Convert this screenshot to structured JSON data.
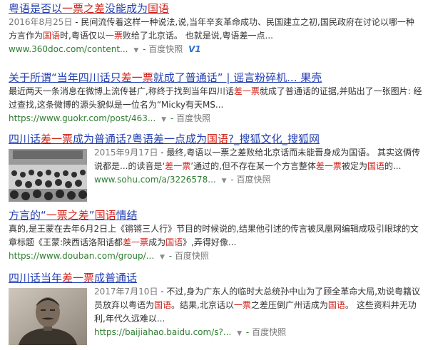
{
  "results": [
    {
      "title": [
        {
          "t": "粤语是否以",
          "hl": false
        },
        {
          "t": "一票之差",
          "hl": true
        },
        {
          "t": "没能成为",
          "hl": false
        },
        {
          "t": "国语",
          "hl": true
        }
      ],
      "date": "2016年8月25日",
      "abstract": [
        {
          "t": " - 民间流传着这样一种说法,说,当年辛亥革命成功、民国建立之初,国民政府在讨论以哪一种方言作为",
          "hl": false
        },
        {
          "t": "国语",
          "hl": true
        },
        {
          "t": "时,粤语仅以",
          "hl": false
        },
        {
          "t": "一票",
          "hl": true
        },
        {
          "t": "败给了北京话。 也就是说,粤语差一点...",
          "hl": false
        }
      ],
      "url": "www.360doc.com/content...",
      "badge": "V1",
      "snapshot": "百度快照"
    },
    {
      "title": [
        {
          "t": "关于所谓“当年四川话只",
          "hl": false
        },
        {
          "t": "差一票",
          "hl": true
        },
        {
          "t": "就成了普通话” | 谣言粉碎机... 果壳",
          "hl": false
        }
      ],
      "date": "",
      "abstract": [
        {
          "t": "最近两天一条消息在微博上流传甚广,称终于找到当年四川话",
          "hl": false
        },
        {
          "t": "差一票",
          "hl": true
        },
        {
          "t": "就成了普通话的证据,并贴出了一张图片: 经过查找,这条微博的源头貌似是一位名为“Micky有天MS...",
          "hl": false
        }
      ],
      "url": "https://www.guokr.com/post/463...",
      "badge": "",
      "snapshot": "百度快照"
    },
    {
      "title": [
        {
          "t": "四川话",
          "hl": false
        },
        {
          "t": "差一票",
          "hl": true
        },
        {
          "t": "成为普通话?粤语差一点成为",
          "hl": false
        },
        {
          "t": "国语",
          "hl": true
        },
        {
          "t": "?_搜狐文化_搜狐网",
          "hl": false
        }
      ],
      "date": "2015年9月17日",
      "abstract": [
        {
          "t": " - 最终,粤语以一票之差败给北京话而未能晋身成为国语。 其实这俩传说都是...的读音是‘",
          "hl": false
        },
        {
          "t": "差一票",
          "hl": true
        },
        {
          "t": "’通过的,但不存在某一个方言整体",
          "hl": false
        },
        {
          "t": "差一票",
          "hl": true
        },
        {
          "t": "被定为",
          "hl": false
        },
        {
          "t": "国语",
          "hl": true
        },
        {
          "t": "的...",
          "hl": false
        }
      ],
      "url": "www.sohu.com/a/3226578...",
      "badge": "",
      "snapshot": "百度快照"
    },
    {
      "title": [
        {
          "t": "方言的“",
          "hl": false
        },
        {
          "t": "一票之差",
          "hl": true
        },
        {
          "t": "”",
          "hl": false
        },
        {
          "t": "国语",
          "hl": true
        },
        {
          "t": "情结",
          "hl": false
        }
      ],
      "date": "",
      "abstract": [
        {
          "t": "真的,是王蒙在去年6月2日上《锵锵三人行》节目的时候说的,结果他引述的传言被凤凰网编辑成吸引眼球的文章标题《王蒙:陕西话洛阳话都",
          "hl": false
        },
        {
          "t": "差一票",
          "hl": true
        },
        {
          "t": "成为",
          "hl": false
        },
        {
          "t": "国语",
          "hl": true
        },
        {
          "t": "》,弄得好像...",
          "hl": false
        }
      ],
      "url": "https://www.douban.com/group/...",
      "badge": "",
      "snapshot": "百度快照"
    },
    {
      "title": [
        {
          "t": "四川话当年",
          "hl": false
        },
        {
          "t": "差一票",
          "hl": true
        },
        {
          "t": "成普通话",
          "hl": false
        }
      ],
      "date": "2017年7月10日",
      "abstract": [
        {
          "t": " - 不过,身为广东人的临时大总统孙中山为了顾全革命大局,劝说粤籍议员放弃以粤语为",
          "hl": false
        },
        {
          "t": "国语",
          "hl": true
        },
        {
          "t": "。结果,北京话以",
          "hl": false
        },
        {
          "t": "一票",
          "hl": true
        },
        {
          "t": "之差压倒广州话成为",
          "hl": false
        },
        {
          "t": "国语",
          "hl": true
        },
        {
          "t": "。 这些资料并无功利,年代久远难以...",
          "hl": false
        }
      ],
      "url": "https://baijiahao.baidu.com/s?...",
      "badge": "",
      "snapshot": "百度快照"
    }
  ]
}
